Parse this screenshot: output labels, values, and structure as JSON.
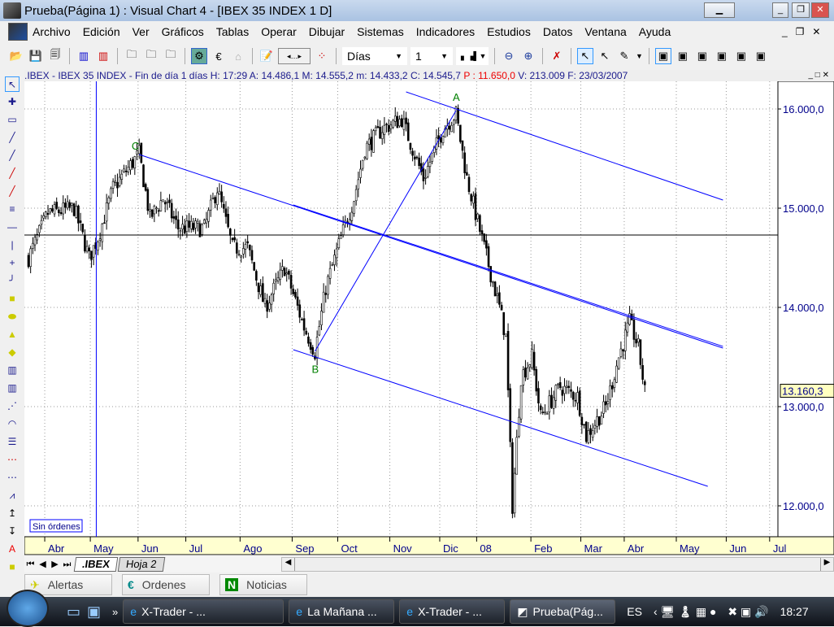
{
  "window": {
    "title": "Prueba(Página 1) : Visual Chart 4 - [IBEX 35 INDEX 1 D]"
  },
  "menu": [
    "Archivo",
    "Edición",
    "Ver",
    "Gráficos",
    "Tablas",
    "Operar",
    "Dibujar",
    "Sistemas",
    "Indicadores",
    "Estudios",
    "Datos",
    "Ventana",
    "Ayuda"
  ],
  "toolbar": {
    "period": "Días",
    "multiplier": "1"
  },
  "info": {
    "prefix": ".IBEX - IBEX 35 INDEX - Fin de día 1 días H: 17:29 A: 14.486,1 M: 14.555,2 m: 14.433,2 C: 14.545,7",
    "p": "P : 11.650,0",
    "suffix": "V: 213.009 F: 23/03/2007"
  },
  "chart_data": {
    "type": "candlestick",
    "symbol": ".IBEX",
    "y_ticks": [
      16000,
      15000,
      14000,
      13000,
      12000
    ],
    "y_tick_labels": [
      "16.000,0",
      "15.000,0",
      "14.000,0",
      "13.000,0",
      "12.000,0"
    ],
    "ylim": [
      11700,
      16300
    ],
    "last_price_label": "13.160,3",
    "x_labels": [
      "Abr",
      "May",
      "Jun",
      "Jul",
      "Ago",
      "Sep",
      "Oct",
      "Nov",
      "Dic",
      "08",
      "Feb",
      "Mar",
      "Abr",
      "May",
      "Jun",
      "Jul"
    ],
    "x_label_bars": [
      12,
      33,
      55,
      77,
      102,
      126,
      147,
      171,
      194,
      211,
      236,
      259,
      279,
      303,
      326,
      346
    ],
    "bars_total": 350,
    "price_path_keypoints": [
      [
        0,
        14500
      ],
      [
        9,
        14950
      ],
      [
        21,
        15000
      ],
      [
        28,
        14500
      ],
      [
        32,
        14700
      ],
      [
        39,
        15200
      ],
      [
        51,
        15550
      ],
      [
        56,
        14900
      ],
      [
        62,
        15100
      ],
      [
        69,
        14800
      ],
      [
        81,
        14800
      ],
      [
        87,
        15200
      ],
      [
        94,
        14600
      ],
      [
        101,
        14600
      ],
      [
        109,
        14000
      ],
      [
        118,
        14400
      ],
      [
        127,
        13800
      ],
      [
        132,
        13550
      ],
      [
        137,
        14200
      ],
      [
        144,
        14700
      ],
      [
        150,
        15100
      ],
      [
        155,
        15600
      ],
      [
        163,
        15800
      ],
      [
        172,
        15900
      ],
      [
        182,
        15300
      ],
      [
        191,
        15800
      ],
      [
        197,
        15950
      ],
      [
        202,
        15300
      ],
      [
        210,
        14600
      ],
      [
        217,
        14000
      ],
      [
        220,
        13700
      ],
      [
        223,
        12000
      ],
      [
        227,
        13300
      ],
      [
        232,
        13500
      ],
      [
        236,
        12900
      ],
      [
        245,
        13200
      ],
      [
        253,
        13100
      ],
      [
        257,
        12700
      ],
      [
        266,
        13000
      ],
      [
        272,
        13500
      ],
      [
        277,
        13850
      ],
      [
        281,
        13600
      ],
      [
        284,
        13150
      ]
    ],
    "trendlines": [
      {
        "from": [
          174,
          16172
        ],
        "to": [
          320,
          15082
        ]
      },
      {
        "from": [
          51,
          15541
        ],
        "to": [
          320,
          13590
        ]
      },
      {
        "from": [
          122,
          15033
        ],
        "to": [
          320,
          13607
        ]
      },
      {
        "from": [
          122,
          13574
        ],
        "to": [
          313,
          12197
        ]
      },
      {
        "from": [
          132,
          13557
        ],
        "to": [
          197,
          15984
        ]
      }
    ],
    "horizontal_line": 14730,
    "vertical_line_bar": 32,
    "wave_labels": [
      {
        "text": "A",
        "bar": 197,
        "price": 16080
      },
      {
        "text": "B",
        "bar": 132,
        "price": 13340
      },
      {
        "text": "C",
        "bar": 49,
        "price": 15590
      }
    ],
    "orders_label": "Sin órdenes"
  },
  "sheets": {
    "tabs": [
      ".IBEX",
      "Hoja 2"
    ]
  },
  "panels": [
    "Alertas",
    "Ordenes",
    "Noticias"
  ],
  "taskbar": {
    "tasks": [
      "X-Trader - ...",
      "La Mañana ...",
      "X-Trader - ...",
      "Prueba(Pág..."
    ],
    "lang": "ES",
    "clock": "18:27"
  },
  "colors": {
    "line": "#0000ff",
    "label": "#008000",
    "axis_text": "#00008b",
    "price_tag": "#ffffc0"
  }
}
